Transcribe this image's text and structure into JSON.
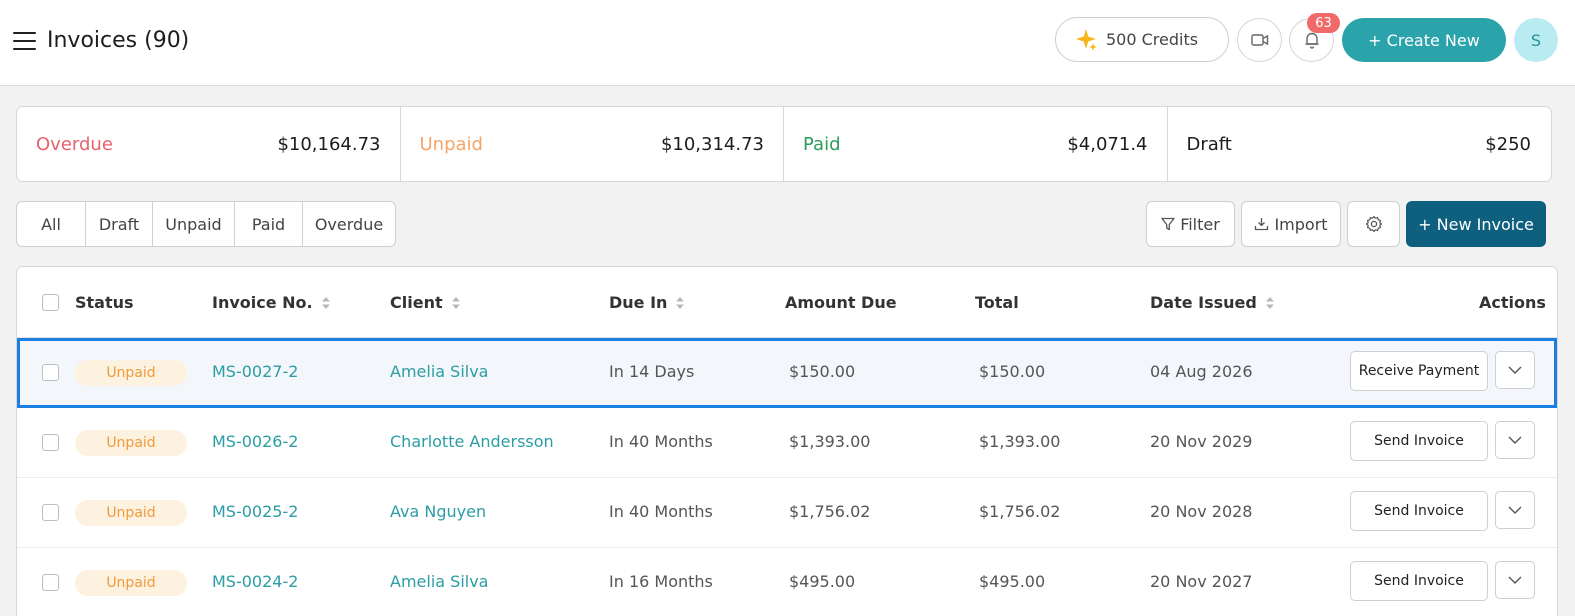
{
  "header": {
    "title": "Invoices (90)",
    "credits_label": "500 Credits",
    "notification_count": "63",
    "create_label": "+ Create New",
    "avatar_initial": "S"
  },
  "summary": [
    {
      "label": "Overdue",
      "value": "$10,164.73",
      "color": "#e8616b"
    },
    {
      "label": "Unpaid",
      "value": "$10,314.73",
      "color": "#f4a66a"
    },
    {
      "label": "Paid",
      "value": "$4,071.4",
      "color": "#2e9c5a"
    },
    {
      "label": "Draft",
      "value": "$250",
      "color": "#1d1d1d"
    }
  ],
  "filters": [
    "All",
    "Draft",
    "Unpaid",
    "Paid",
    "Overdue"
  ],
  "toolbar": {
    "filter_label": "Filter",
    "import_label": "Import",
    "new_invoice_label": "+ New Invoice"
  },
  "table": {
    "columns": {
      "status": "Status",
      "invoice_no": "Invoice No.",
      "client": "Client",
      "due_in": "Due In",
      "amount_due": "Amount Due",
      "total": "Total",
      "date_issued": "Date Issued",
      "actions": "Actions"
    },
    "rows": [
      {
        "status": "Unpaid",
        "invoice_no": "MS-0027-2",
        "client": "Amelia Silva",
        "due_in": "In 14 Days",
        "amount_due": "$150.00",
        "total": "$150.00",
        "date_issued": "04 Aug 2026",
        "action": "Receive Payment",
        "selected": true
      },
      {
        "status": "Unpaid",
        "invoice_no": "MS-0026-2",
        "client": "Charlotte Andersson",
        "due_in": "In 40 Months",
        "amount_due": "$1,393.00",
        "total": "$1,393.00",
        "date_issued": "20 Nov 2029",
        "action": "Send Invoice",
        "selected": false
      },
      {
        "status": "Unpaid",
        "invoice_no": "MS-0025-2",
        "client": "Ava Nguyen",
        "due_in": "In 40 Months",
        "amount_due": "$1,756.02",
        "total": "$1,756.02",
        "date_issued": "20 Nov 2028",
        "action": "Send Invoice",
        "selected": false
      },
      {
        "status": "Unpaid",
        "invoice_no": "MS-0024-2",
        "client": "Amelia Silva",
        "due_in": "In 16 Months",
        "amount_due": "$495.00",
        "total": "$495.00",
        "date_issued": "20 Nov 2027",
        "action": "Send Invoice",
        "selected": false
      }
    ]
  },
  "colors": {
    "accent": "#2ba3aa",
    "primary": "#0f607e",
    "badge": "#f06a6a",
    "selected_outline": "#1a7fe0"
  },
  "icons": [
    "menu-icon",
    "sparkle-icon",
    "video-icon",
    "bell-icon",
    "filter-icon",
    "download-icon",
    "gear-icon",
    "sort-icon",
    "chevron-down-icon"
  ]
}
